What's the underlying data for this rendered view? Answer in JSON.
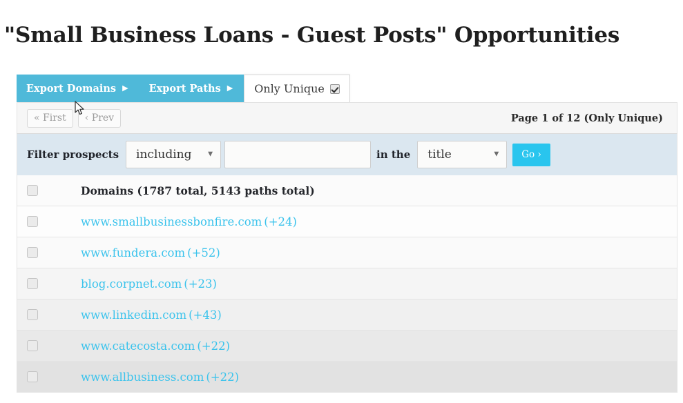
{
  "page": {
    "title": "\"Small Business Loans - Guest Posts\" Opportunities"
  },
  "toolbar": {
    "export_domains_label": "Export Domains",
    "export_domains_arrow": "▶",
    "export_paths_label": "Export Paths",
    "export_paths_arrow": "▶",
    "only_unique_label": "Only Unique",
    "only_unique_checked": true,
    "accent_color": "#4fb9d9"
  },
  "pager": {
    "first_label": "« First",
    "prev_label": "‹ Prev",
    "info": "Page 1 of 12 (Only Unique)"
  },
  "filter": {
    "label": "Filter prospects",
    "mode_value": "including",
    "mode_caret": "▼",
    "query_value": "",
    "query_placeholder": "",
    "in_the_label": "in the",
    "field_value": "title",
    "field_caret": "▼",
    "go_label": "Go ›",
    "go_color": "#29c5ee",
    "bar_color": "#dbe7f0"
  },
  "table": {
    "header": "Domains (1787 total, 5143 paths total)",
    "link_color": "#3bc3ec",
    "rows": [
      {
        "domain": "www.smallbusinessbonfire.com",
        "count": "(+24)"
      },
      {
        "domain": "www.fundera.com",
        "count": "(+52)"
      },
      {
        "domain": "blog.corpnet.com",
        "count": "(+23)"
      },
      {
        "domain": "www.linkedin.com",
        "count": "(+43)"
      },
      {
        "domain": "www.catecosta.com",
        "count": "(+22)"
      },
      {
        "domain": "www.allbusiness.com",
        "count": "(+22)"
      }
    ]
  }
}
